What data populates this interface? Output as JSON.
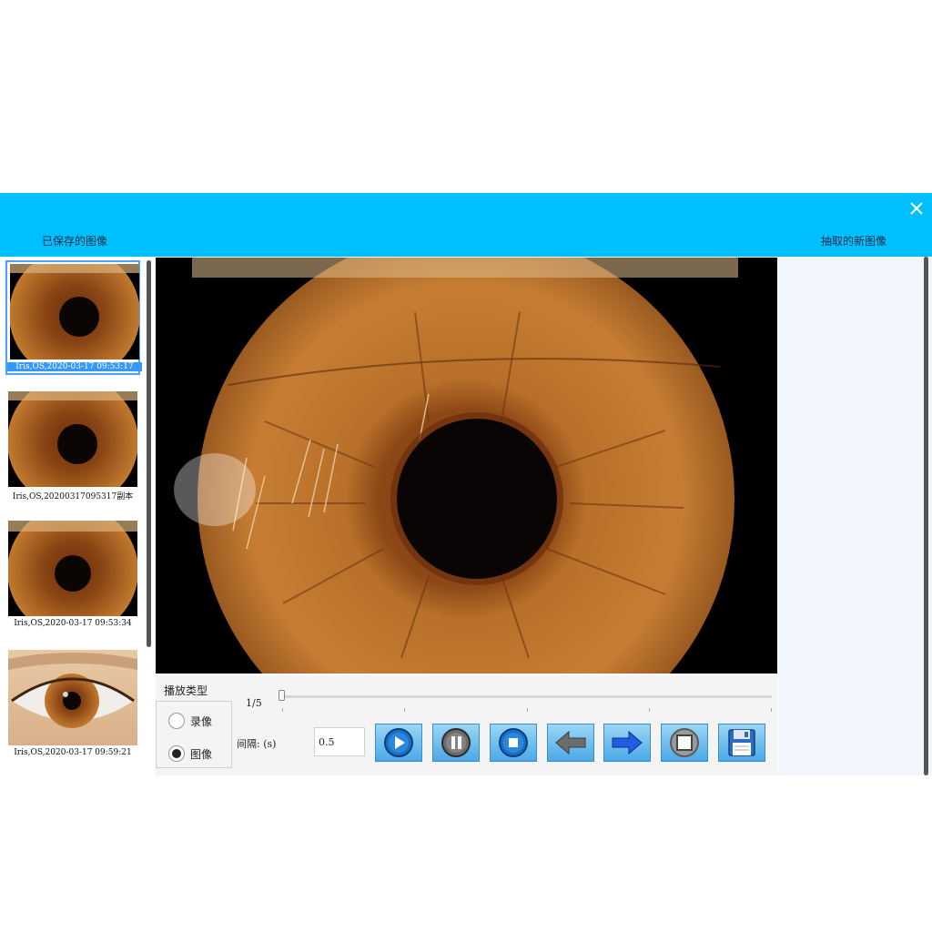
{
  "window": {
    "saved_images_label": "已保存的图像",
    "new_images_label": "抽取的新图像",
    "close_icon": "close-icon"
  },
  "thumbnails": [
    {
      "caption": "Iris,OS,2020-03-17 09:53:17",
      "selected": true
    },
    {
      "caption": "Iris,OS,20200317095317副本",
      "selected": false
    },
    {
      "caption": "Iris,OS,2020-03-17 09:53:34",
      "selected": false
    },
    {
      "caption": "Iris,OS,2020-03-17 09:59:21",
      "selected": false
    }
  ],
  "playback": {
    "group_title": "播放类型",
    "options": [
      {
        "label": "录像",
        "checked": false
      },
      {
        "label": "图像",
        "checked": true
      }
    ],
    "frame_counter": "1/5",
    "interval_label": "间隔: (s)",
    "interval_value": "0.5"
  },
  "toolbar": {
    "buttons": [
      "play-icon",
      "pause-icon",
      "stop-icon",
      "arrow-left-icon",
      "arrow-right-icon",
      "capture-icon",
      "save-icon"
    ]
  },
  "colors": {
    "titlebar": "#00bfff",
    "selection": "#3399ff",
    "iris": "#b8702a"
  }
}
